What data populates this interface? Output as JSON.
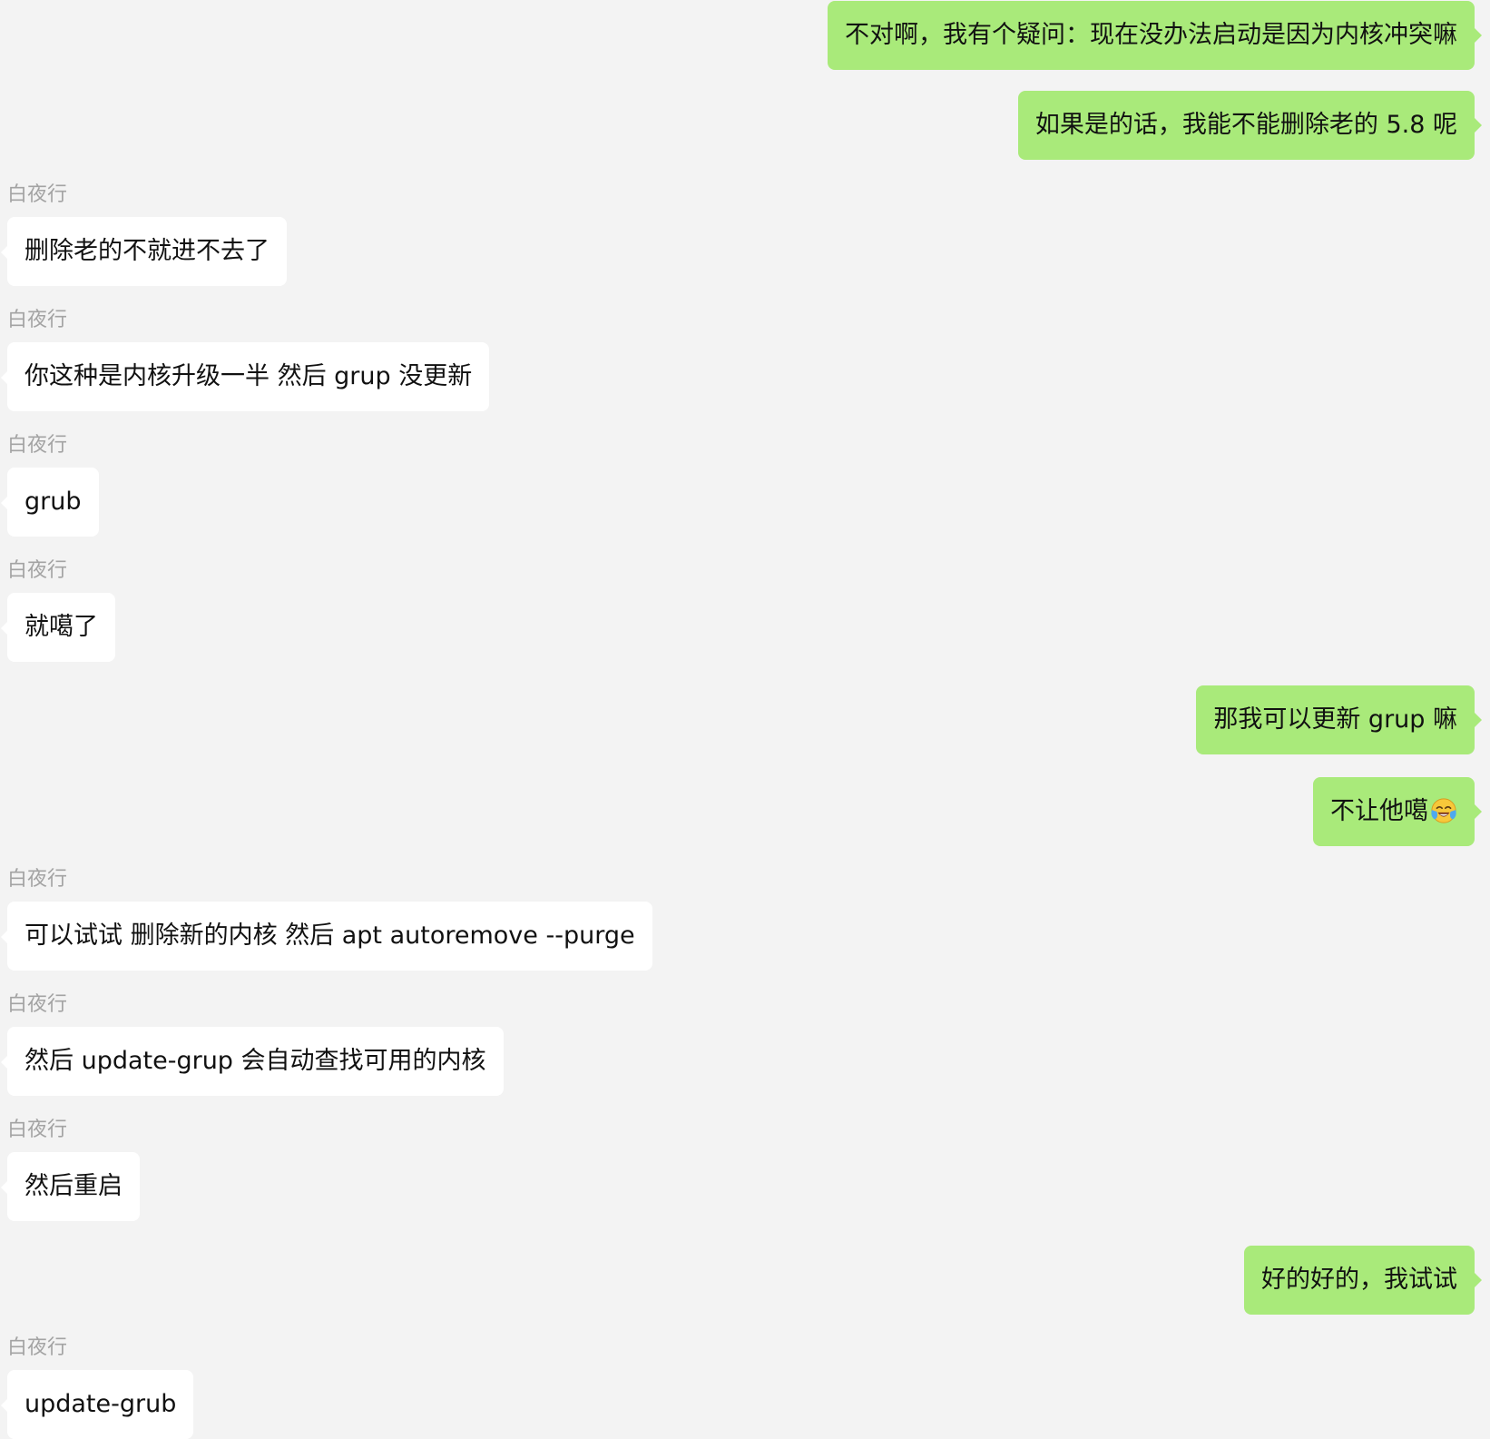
{
  "chat": {
    "messages": [
      {
        "direction": "outgoing",
        "text": "不对啊，我有个疑问：现在没办法启动是因为内核冲突嘛"
      },
      {
        "direction": "outgoing",
        "text": "如果是的话，我能不能删除老的 5.8 呢"
      },
      {
        "direction": "incoming",
        "sender": "白夜行",
        "text": "删除老的不就进不去了"
      },
      {
        "direction": "incoming",
        "sender": "白夜行",
        "text": "你这种是内核升级一半 然后 grup 没更新"
      },
      {
        "direction": "incoming",
        "sender": "白夜行",
        "text": "grub"
      },
      {
        "direction": "incoming",
        "sender": "白夜行",
        "text": "就噶了"
      },
      {
        "direction": "outgoing",
        "text": "那我可以更新 grup 嘛"
      },
      {
        "direction": "outgoing",
        "text": "不让他噶",
        "emoji": "laughing-crying-emoji"
      },
      {
        "direction": "incoming",
        "sender": "白夜行",
        "text": "可以试试 删除新的内核 然后 apt autoremove --purge"
      },
      {
        "direction": "incoming",
        "sender": "白夜行",
        "text": "然后 update-grup 会自动查找可用的内核"
      },
      {
        "direction": "incoming",
        "sender": "白夜行",
        "text": "然后重启"
      },
      {
        "direction": "outgoing",
        "text": "好的好的，我试试"
      },
      {
        "direction": "incoming",
        "sender": "白夜行",
        "text": "update-grub"
      }
    ]
  },
  "colors": {
    "background": "#f3f3f3",
    "outgoing_bubble": "#a9ea7a",
    "incoming_bubble": "#ffffff",
    "sender_name": "#a3a3a3",
    "text": "#111111"
  }
}
